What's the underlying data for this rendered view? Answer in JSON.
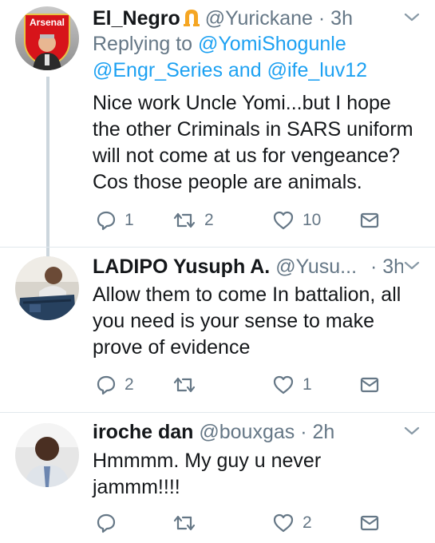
{
  "tweets": [
    {
      "name": "El_Negro",
      "handle": "@Yurickane",
      "dot": "·",
      "time": "3h",
      "avatar_text": "Arsenal",
      "reply_label": "Replying to",
      "reply_mention_1": "@YomiShogunle",
      "reply_mention_2": "@Engr_Series",
      "reply_and": "and",
      "reply_mention_3": "@ife_luv12",
      "lines": [
        "Nice work Uncle Yomi...but I hope",
        "the other Criminals in SARS uniform",
        "will not come at us for vengeance?",
        "Cos those people are animals."
      ],
      "reply_count": "1",
      "retweet_count": "2",
      "like_count": "10"
    },
    {
      "name": "LADIPO Yusuph A.",
      "handle": "@Yusu...",
      "dot": "·",
      "time": "3h",
      "lines": [
        "Allow them to come In battalion, all",
        "you need is your sense to make",
        "prove of evidence"
      ],
      "reply_count": "2",
      "retweet_count": "",
      "like_count": "1"
    },
    {
      "name": "iroche dan",
      "handle": "@bouxgas",
      "dot": "·",
      "time": "2h",
      "lines": [
        "Hmmmm. My guy u never",
        "jammm!!!!"
      ],
      "reply_count": "",
      "retweet_count": "",
      "like_count": "2"
    }
  ],
  "icons": {
    "reply": "reply-icon",
    "retweet": "retweet-icon",
    "like": "heart-icon",
    "dm": "mail-icon",
    "caret": "chevron-down-icon",
    "badge": "horseshoe-emoji-icon"
  },
  "colors": {
    "text": "#14171a",
    "secondary": "#657786",
    "link": "#1da1f2",
    "thread_line": "#ccd6dd",
    "divider": "#e1e8ed",
    "badge": "#f5a623"
  }
}
